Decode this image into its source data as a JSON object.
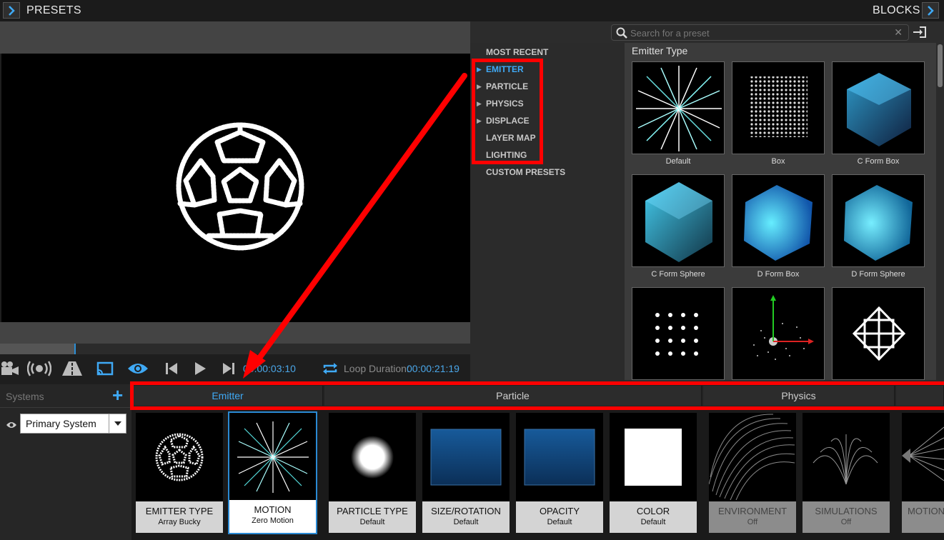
{
  "header": {
    "left_title": "PRESETS",
    "right_title": "BLOCKS"
  },
  "transport": {
    "current_time": "00:00:03:10",
    "loop_label": "Loop Duration:",
    "loop_value": "00:00:21:19"
  },
  "search": {
    "placeholder": "Search for a preset"
  },
  "categories": [
    {
      "label": "MOST RECENT",
      "has_arrow": false,
      "active": false
    },
    {
      "label": "EMITTER",
      "has_arrow": true,
      "active": true
    },
    {
      "label": "PARTICLE",
      "has_arrow": true,
      "active": false
    },
    {
      "label": "PHYSICS",
      "has_arrow": true,
      "active": false
    },
    {
      "label": "DISPLACE",
      "has_arrow": true,
      "active": false
    },
    {
      "label": "LAYER MAP",
      "has_arrow": false,
      "active": false
    },
    {
      "label": "LIGHTING",
      "has_arrow": false,
      "active": false
    },
    {
      "label": "CUSTOM PRESETS",
      "has_arrow": false,
      "active": false
    }
  ],
  "preset_grid": {
    "header": "Emitter Type",
    "items": [
      {
        "label": "Default"
      },
      {
        "label": "Box"
      },
      {
        "label": "C Form Box"
      },
      {
        "label": "C Form Sphere"
      },
      {
        "label": "D Form Box"
      },
      {
        "label": "D Form Sphere"
      },
      {
        "label": ""
      },
      {
        "label": ""
      },
      {
        "label": ""
      }
    ]
  },
  "systems": {
    "label": "Systems",
    "add_symbol": "+",
    "selected": "Primary System"
  },
  "tabs": [
    {
      "label": "Emitter",
      "active": true
    },
    {
      "label": "Particle",
      "active": false
    },
    {
      "label": "Physics",
      "active": false
    }
  ],
  "blocks": [
    {
      "title": "EMITTER TYPE",
      "sub": "Array Bucky",
      "state": "normal"
    },
    {
      "title": "MOTION",
      "sub": "Zero Motion",
      "state": "selected"
    },
    {
      "title": "PARTICLE TYPE",
      "sub": "Default",
      "state": "normal"
    },
    {
      "title": "SIZE/ROTATION",
      "sub": "Default",
      "state": "normal"
    },
    {
      "title": "OPACITY",
      "sub": "Default",
      "state": "normal"
    },
    {
      "title": "COLOR",
      "sub": "Default",
      "state": "normal"
    },
    {
      "title": "ENVIRONMENT",
      "sub": "Off",
      "state": "dim"
    },
    {
      "title": "SIMULATIONS",
      "sub": "Off",
      "state": "dim"
    },
    {
      "title": "MOTION",
      "sub": "",
      "state": "dim"
    }
  ],
  "colors": {
    "accent": "#3fa9f5",
    "annotation": "#ff0000"
  }
}
